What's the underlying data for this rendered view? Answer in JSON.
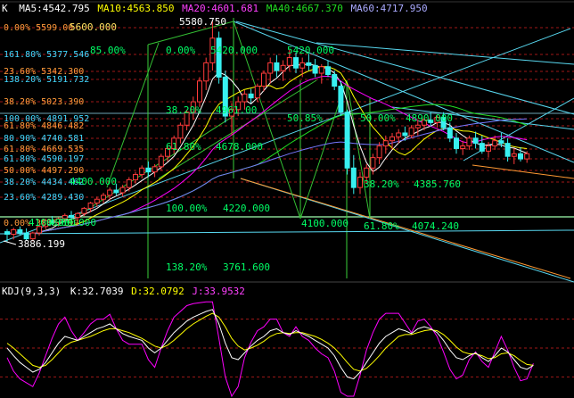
{
  "colors": {
    "bg": "#000000",
    "up": "#ff3b3b",
    "down": "#38f0f0",
    "ma5": "#ffffff",
    "ma10": "#ffff00",
    "ma20": "#ff00ff",
    "ma40": "#22dd22",
    "ma60": "#7777ff",
    "fib_text": "#00ff66",
    "fib_text_left": "#40d8ff",
    "fib_text_orange": "#ff9a3a",
    "grid_red": "#a01818",
    "trend": "#58d8f0",
    "orange_line": "#ff9933"
  },
  "price_header": {
    "symbol": "K",
    "ma5_label": "MA5:4542.795",
    "ma10_label": "MA10:4563.850",
    "ma20_label": "MA20:4601.681",
    "ma40_label": "MA40:4667.370",
    "ma60_label": "MA60:4717.950"
  },
  "kdj_header": {
    "name": "KDJ(9,3,3)",
    "k_label": "K:32.7039",
    "d_label": "D:32.0792",
    "j_label": "J:33.9532"
  },
  "price_labels": {
    "high": "5580.750",
    "low": "3886.199"
  },
  "fib_left_levels": [
    "0.00% 5599.00",
    "161.80% 5377.546",
    "23.60% 5342.300",
    "138.20% 5191.732",
    "38.20% 5023.390",
    "100.00% 4891.952",
    "61.80% 4846.482",
    "80.90% 4740.581",
    "61.80% 4669.535",
    "61.80% 4590.197",
    "50.00% 4497.290",
    "38.20% 4434.462",
    "23.60% 4289.430",
    "0.00% 3886.199"
  ],
  "fib_annotations": [
    "5600.000",
    "85.00%",
    "0.00%",
    "5420.000",
    "5420.000",
    "38.20%",
    "4961.00",
    "50.85%",
    "50.00%",
    "4890.000",
    "61.80%",
    "4678.000",
    "4400.000",
    "100.00%",
    "4220.000",
    "38.20%",
    "4385.760",
    "4100.000",
    "61.80%",
    "4074.240",
    "138.20%",
    "3761.600",
    "4100.000",
    "4000.000"
  ],
  "chart_data": {
    "type": "candlestick",
    "y_range": [
      3600,
      5620
    ],
    "candles": [
      [
        3960,
        3980,
        3880,
        3940
      ],
      [
        3940,
        3990,
        3900,
        3975
      ],
      [
        3975,
        4000,
        3930,
        3950
      ],
      [
        3950,
        3985,
        3890,
        3905
      ],
      [
        3905,
        3960,
        3886,
        3950
      ],
      [
        3950,
        4010,
        3930,
        4000
      ],
      [
        4000,
        4060,
        3980,
        4045
      ],
      [
        4045,
        4080,
        4010,
        4030
      ],
      [
        4030,
        4070,
        4000,
        4060
      ],
      [
        4060,
        4100,
        4030,
        4085
      ],
      [
        4085,
        4120,
        4050,
        4070
      ],
      [
        4070,
        4110,
        4040,
        4100
      ],
      [
        4100,
        4150,
        4080,
        4140
      ],
      [
        4140,
        4190,
        4110,
        4180
      ],
      [
        4180,
        4230,
        4150,
        4210
      ],
      [
        4210,
        4260,
        4180,
        4240
      ],
      [
        4240,
        4300,
        4200,
        4280
      ],
      [
        4280,
        4330,
        4240,
        4260
      ],
      [
        4260,
        4320,
        4230,
        4300
      ],
      [
        4300,
        4380,
        4270,
        4360
      ],
      [
        4360,
        4420,
        4330,
        4400
      ],
      [
        4400,
        4470,
        4370,
        4450
      ],
      [
        4450,
        4500,
        4380,
        4420
      ],
      [
        4420,
        4480,
        4380,
        4460
      ],
      [
        4460,
        4560,
        4430,
        4540
      ],
      [
        4540,
        4620,
        4500,
        4600
      ],
      [
        4600,
        4700,
        4560,
        4680
      ],
      [
        4680,
        4800,
        4640,
        4780
      ],
      [
        4780,
        4900,
        4740,
        4880
      ],
      [
        4880,
        5000,
        4820,
        4960
      ],
      [
        4960,
        5150,
        4920,
        5120
      ],
      [
        5120,
        5300,
        5050,
        5260
      ],
      [
        5260,
        5580,
        5200,
        5450
      ],
      [
        5450,
        5500,
        5100,
        5150
      ],
      [
        5150,
        5200,
        4800,
        4850
      ],
      [
        4850,
        4950,
        4700,
        4900
      ],
      [
        4900,
        5000,
        4850,
        4960
      ],
      [
        4960,
        5050,
        4900,
        5020
      ],
      [
        5020,
        5060,
        4950,
        4990
      ],
      [
        4990,
        5100,
        4960,
        5080
      ],
      [
        5080,
        5200,
        5040,
        5180
      ],
      [
        5180,
        5300,
        5100,
        5260
      ],
      [
        5260,
        5320,
        5150,
        5200
      ],
      [
        5200,
        5280,
        5120,
        5240
      ],
      [
        5240,
        5360,
        5200,
        5300
      ],
      [
        5300,
        5340,
        5180,
        5220
      ],
      [
        5220,
        5300,
        5150,
        5260
      ],
      [
        5260,
        5330,
        5200,
        5240
      ],
      [
        5240,
        5290,
        5150,
        5180
      ],
      [
        5180,
        5250,
        5100,
        5230
      ],
      [
        5230,
        5280,
        5150,
        5170
      ],
      [
        5170,
        5200,
        5050,
        5080
      ],
      [
        5080,
        5120,
        4850,
        4880
      ],
      [
        4880,
        4900,
        4400,
        4450
      ],
      [
        4450,
        4550,
        4250,
        4300
      ],
      [
        4300,
        4420,
        4250,
        4380
      ],
      [
        4380,
        4480,
        4330,
        4450
      ],
      [
        4450,
        4560,
        4400,
        4530
      ],
      [
        4530,
        4650,
        4480,
        4620
      ],
      [
        4620,
        4700,
        4560,
        4660
      ],
      [
        4660,
        4720,
        4600,
        4690
      ],
      [
        4690,
        4750,
        4640,
        4720
      ],
      [
        4720,
        4770,
        4660,
        4700
      ],
      [
        4700,
        4780,
        4680,
        4760
      ],
      [
        4760,
        4820,
        4700,
        4780
      ],
      [
        4780,
        4850,
        4740,
        4820
      ],
      [
        4820,
        4880,
        4770,
        4800
      ],
      [
        4800,
        4860,
        4760,
        4840
      ],
      [
        4840,
        4880,
        4740,
        4760
      ],
      [
        4760,
        4800,
        4650,
        4680
      ],
      [
        4680,
        4720,
        4560,
        4600
      ],
      [
        4600,
        4660,
        4550,
        4620
      ],
      [
        4620,
        4700,
        4590,
        4680
      ],
      [
        4680,
        4730,
        4600,
        4640
      ],
      [
        4640,
        4700,
        4560,
        4580
      ],
      [
        4580,
        4650,
        4530,
        4620
      ],
      [
        4620,
        4700,
        4590,
        4660
      ],
      [
        4660,
        4720,
        4610,
        4640
      ],
      [
        4640,
        4680,
        4500,
        4540
      ],
      [
        4540,
        4600,
        4480,
        4560
      ],
      [
        4560,
        4610,
        4500,
        4520
      ],
      [
        4520,
        4580,
        4490,
        4560
      ]
    ],
    "kdj": {
      "k": [
        50,
        42,
        35,
        30,
        25,
        28,
        35,
        45,
        55,
        62,
        60,
        58,
        62,
        66,
        70,
        72,
        75,
        70,
        65,
        62,
        60,
        58,
        50,
        45,
        50,
        58,
        66,
        72,
        78,
        82,
        85,
        88,
        90,
        75,
        55,
        40,
        38,
        45,
        52,
        58,
        62,
        68,
        70,
        66,
        64,
        68,
        65,
        62,
        58,
        54,
        50,
        42,
        30,
        20,
        18,
        25,
        35,
        45,
        55,
        62,
        66,
        70,
        68,
        65,
        70,
        72,
        70,
        66,
        58,
        48,
        40,
        38,
        42,
        45,
        40,
        36,
        42,
        50,
        46,
        38,
        30,
        28,
        32
      ],
      "d": [
        55,
        50,
        44,
        38,
        32,
        30,
        32,
        38,
        45,
        52,
        56,
        58,
        60,
        62,
        65,
        68,
        70,
        70,
        68,
        66,
        63,
        60,
        56,
        52,
        50,
        53,
        58,
        64,
        70,
        75,
        79,
        83,
        86,
        82,
        72,
        60,
        52,
        48,
        50,
        53,
        57,
        62,
        65,
        66,
        65,
        66,
        66,
        64,
        62,
        59,
        55,
        50,
        43,
        35,
        28,
        26,
        29,
        35,
        42,
        50,
        56,
        62,
        64,
        64,
        66,
        68,
        69,
        68,
        64,
        58,
        51,
        46,
        44,
        44,
        42,
        39,
        40,
        44,
        45,
        42,
        37,
        33,
        32
      ],
      "j": [
        40,
        26,
        18,
        14,
        10,
        24,
        42,
        60,
        75,
        82,
        68,
        58,
        66,
        75,
        80,
        80,
        85,
        70,
        58,
        54,
        54,
        54,
        38,
        30,
        50,
        68,
        82,
        88,
        94,
        96,
        97,
        98,
        98,
        60,
        20,
        0,
        10,
        40,
        56,
        68,
        72,
        80,
        80,
        66,
        62,
        72,
        62,
        58,
        50,
        44,
        40,
        26,
        4,
        0,
        0,
        22,
        48,
        66,
        80,
        86,
        86,
        86,
        76,
        66,
        78,
        80,
        72,
        62,
        46,
        28,
        18,
        22,
        38,
        46,
        36,
        30,
        46,
        62,
        48,
        30,
        16,
        18,
        34
      ]
    }
  }
}
